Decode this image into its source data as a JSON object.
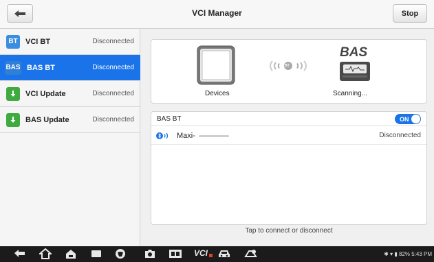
{
  "header": {
    "title": "VCI Manager",
    "stop_label": "Stop"
  },
  "sidebar": {
    "items": [
      {
        "icon_text": "BT",
        "label": "VCI BT",
        "status": "Disconnected",
        "icon": "bluetooth-badge-icon"
      },
      {
        "icon_text": "BAS",
        "label": "BAS BT",
        "status": "Disconnected",
        "icon": "bas-badge-icon",
        "selected": true
      },
      {
        "icon_text": "",
        "label": "VCI Update",
        "status": "Disconnected",
        "icon": "download-icon"
      },
      {
        "icon_text": "",
        "label": "BAS Update",
        "status": "Disconnected",
        "icon": "download-icon"
      }
    ]
  },
  "devices_card": {
    "devices_label": "Devices",
    "scanning_label": "Scanning...",
    "bas_logo_text": "BAS",
    "signal_badge_text": "BT"
  },
  "bt_panel": {
    "title": "BAS BT",
    "toggle_label": "ON",
    "toggle_on": true,
    "devices": [
      {
        "name": "Maxi-",
        "status": "Disconnected"
      }
    ]
  },
  "hint": "Tap to connect or disconnect",
  "navbar": {
    "vci_label": "VCI",
    "status_text": "82% 5:43 PM"
  },
  "colors": {
    "accent": "#1a73e8",
    "update_green": "#3faa3f",
    "nav_bg": "#1b1b1b"
  }
}
